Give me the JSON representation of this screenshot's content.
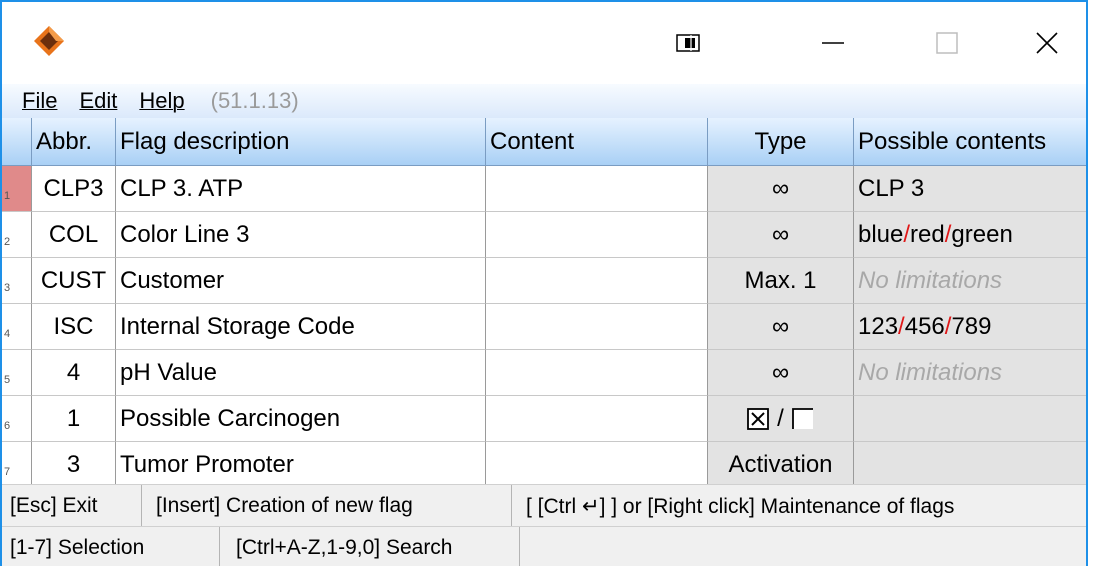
{
  "menu": {
    "file": "File",
    "edit": "Edit",
    "help": "Help",
    "version": "(51.1.13)"
  },
  "headers": {
    "abbr": "Abbr.",
    "desc": "Flag description",
    "content": "Content",
    "type": "Type",
    "possible": "Possible contents"
  },
  "rows": [
    {
      "num": "1",
      "abbr": "CLP3",
      "desc": "CLP 3. ATP",
      "content": "",
      "type": "∞",
      "possible": [
        "CLP 3"
      ]
    },
    {
      "num": "2",
      "abbr": "COL",
      "desc": "Color Line 3",
      "content": "",
      "type": "∞",
      "possible": [
        "blue",
        "red",
        "green"
      ]
    },
    {
      "num": "3",
      "abbr": "CUST",
      "desc": "Customer",
      "content": "",
      "type": "Max. 1",
      "possible_placeholder": "No limitations"
    },
    {
      "num": "4",
      "abbr": "ISC",
      "desc": "Internal Storage Code",
      "content": "",
      "type": "∞",
      "possible": [
        "123",
        "456",
        "789"
      ]
    },
    {
      "num": "5",
      "abbr": "4",
      "desc": "pH Value",
      "content": "",
      "type": "∞",
      "possible_placeholder": "No limitations"
    },
    {
      "num": "6",
      "abbr": "1",
      "desc": "Possible Carcinogen",
      "content": "",
      "type_sep": "/",
      "possible": []
    },
    {
      "num": "7",
      "abbr": "3",
      "desc": "Tumor Promoter",
      "content": "",
      "type": "Activation",
      "possible": []
    }
  ],
  "separator": "/",
  "status": {
    "exit": "[Esc] Exit",
    "insert": "[Insert] Creation of new flag",
    "maint": "[ [Ctrl ↵] ] or [Right click] Maintenance of flags",
    "select": "[1-7] Selection",
    "search": "[Ctrl+A-Z,1-9,0] Search"
  },
  "colors": {
    "accent": "#1e90e8",
    "separator": "#e01818",
    "selected_row_marker": "#e08a8a"
  }
}
